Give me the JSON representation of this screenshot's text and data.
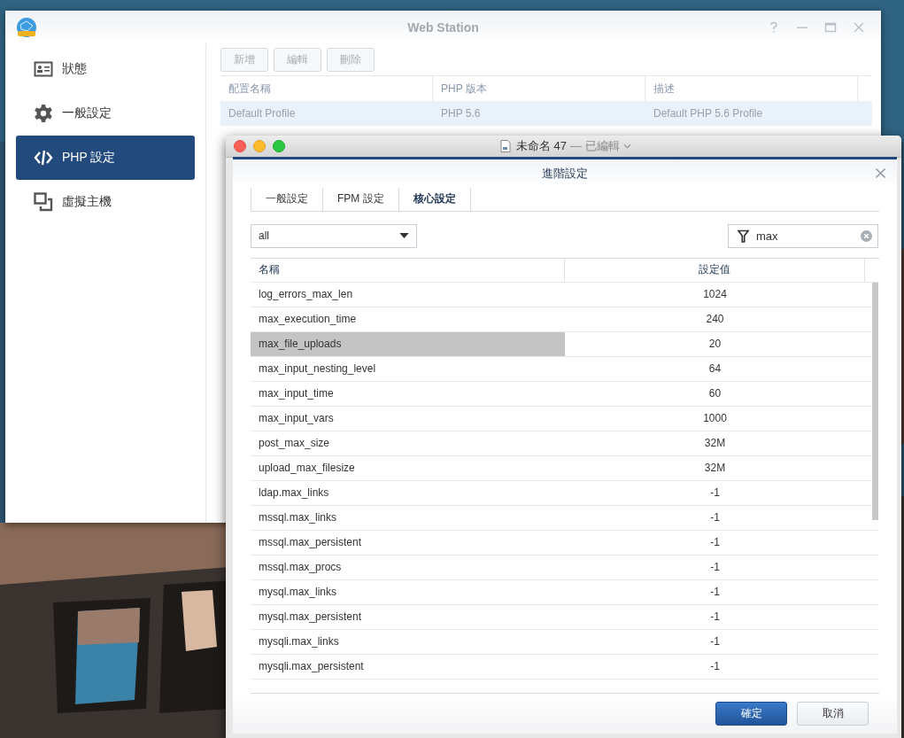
{
  "web_station": {
    "title": "Web Station",
    "sidebar": [
      {
        "label": "狀態",
        "kind": "status",
        "selected": false
      },
      {
        "label": "一般設定",
        "kind": "general",
        "selected": false
      },
      {
        "label": "PHP 設定",
        "kind": "php",
        "selected": true
      },
      {
        "label": "虛擬主機",
        "kind": "vhost",
        "selected": false
      }
    ],
    "toolbar": [
      {
        "label": "新增",
        "disabled": true
      },
      {
        "label": "編輯",
        "disabled": true
      },
      {
        "label": "刪除",
        "disabled": true
      }
    ],
    "table": {
      "columns": [
        "配置名稱",
        "PHP 版本",
        "描述"
      ],
      "rows": [
        {
          "cells": [
            "Default Profile",
            "PHP 5.6",
            "Default PHP 5.6 Profile"
          ],
          "selected": true
        }
      ]
    }
  },
  "editor_window": {
    "title": "未命名 47",
    "status": "— 已編輯"
  },
  "dialog": {
    "title": "進階設定",
    "tabs": [
      {
        "label": "一般設定",
        "selected": false
      },
      {
        "label": "FPM 設定",
        "selected": false
      },
      {
        "label": "核心設定",
        "selected": true
      }
    ],
    "dropdown": {
      "value": "all"
    },
    "filter": {
      "value": "max"
    },
    "columns": [
      "名稱",
      "設定值"
    ],
    "rows": [
      {
        "name": "log_errors_max_len",
        "value": "1024",
        "selected": false
      },
      {
        "name": "max_execution_time",
        "value": "240",
        "selected": false
      },
      {
        "name": "max_file_uploads",
        "value": "20",
        "selected": true
      },
      {
        "name": "max_input_nesting_level",
        "value": "64",
        "selected": false
      },
      {
        "name": "max_input_time",
        "value": "60",
        "selected": false
      },
      {
        "name": "max_input_vars",
        "value": "1000",
        "selected": false
      },
      {
        "name": "post_max_size",
        "value": "32M",
        "selected": false
      },
      {
        "name": "upload_max_filesize",
        "value": "32M",
        "selected": false
      },
      {
        "name": "ldap.max_links",
        "value": "-1",
        "selected": false
      },
      {
        "name": "mssql.max_links",
        "value": "-1",
        "selected": false
      },
      {
        "name": "mssql.max_persistent",
        "value": "-1",
        "selected": false
      },
      {
        "name": "mssql.max_procs",
        "value": "-1",
        "selected": false
      },
      {
        "name": "mysql.max_links",
        "value": "-1",
        "selected": false
      },
      {
        "name": "mysql.max_persistent",
        "value": "-1",
        "selected": false
      },
      {
        "name": "mysqli.max_links",
        "value": "-1",
        "selected": false
      },
      {
        "name": "mysqli.max_persistent",
        "value": "-1",
        "selected": false
      }
    ],
    "buttons": [
      {
        "label": "確定",
        "kind": "primary"
      },
      {
        "label": "取消",
        "kind": "secondary"
      }
    ]
  }
}
